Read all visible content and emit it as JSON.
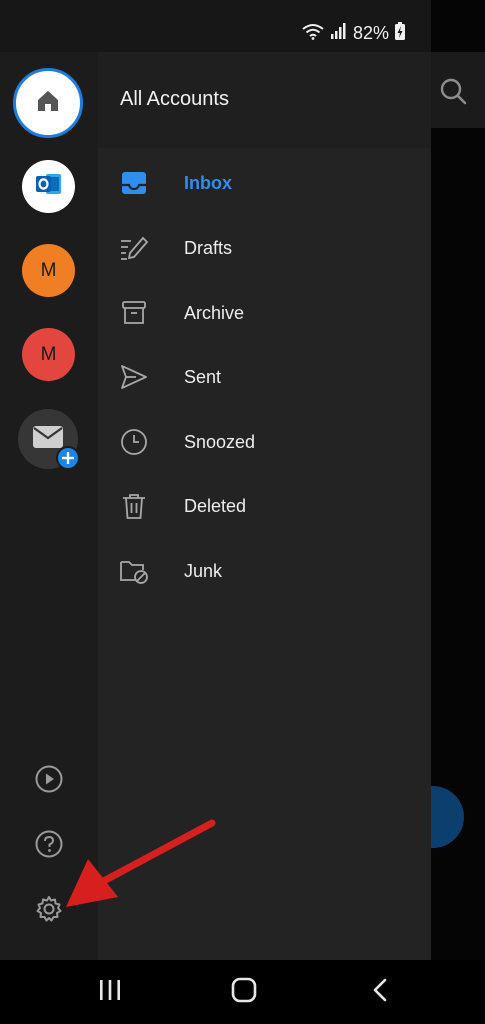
{
  "status_bar": {
    "battery": "82%"
  },
  "drawer": {
    "title": "All Accounts",
    "accounts": {
      "m1_initial": "M",
      "m2_initial": "M"
    },
    "folders": [
      {
        "label": "Inbox",
        "icon": "inbox-icon",
        "active": true
      },
      {
        "label": "Drafts",
        "icon": "drafts-icon",
        "active": false
      },
      {
        "label": "Archive",
        "icon": "archive-icon",
        "active": false
      },
      {
        "label": "Sent",
        "icon": "sent-icon",
        "active": false
      },
      {
        "label": "Snoozed",
        "icon": "snoozed-icon",
        "active": false
      },
      {
        "label": "Deleted",
        "icon": "trash-icon",
        "active": false
      },
      {
        "label": "Junk",
        "icon": "junk-icon",
        "active": false
      }
    ],
    "rail_actions": [
      "play-icon",
      "help-icon",
      "settings-icon"
    ]
  },
  "colors": {
    "accent": "#2f8ef0",
    "account_m1": "#ef7f22",
    "account_m2": "#e2463f",
    "annotation_arrow": "#d71f1f"
  },
  "nav": [
    "recent-apps-icon",
    "home-icon",
    "back-icon"
  ]
}
